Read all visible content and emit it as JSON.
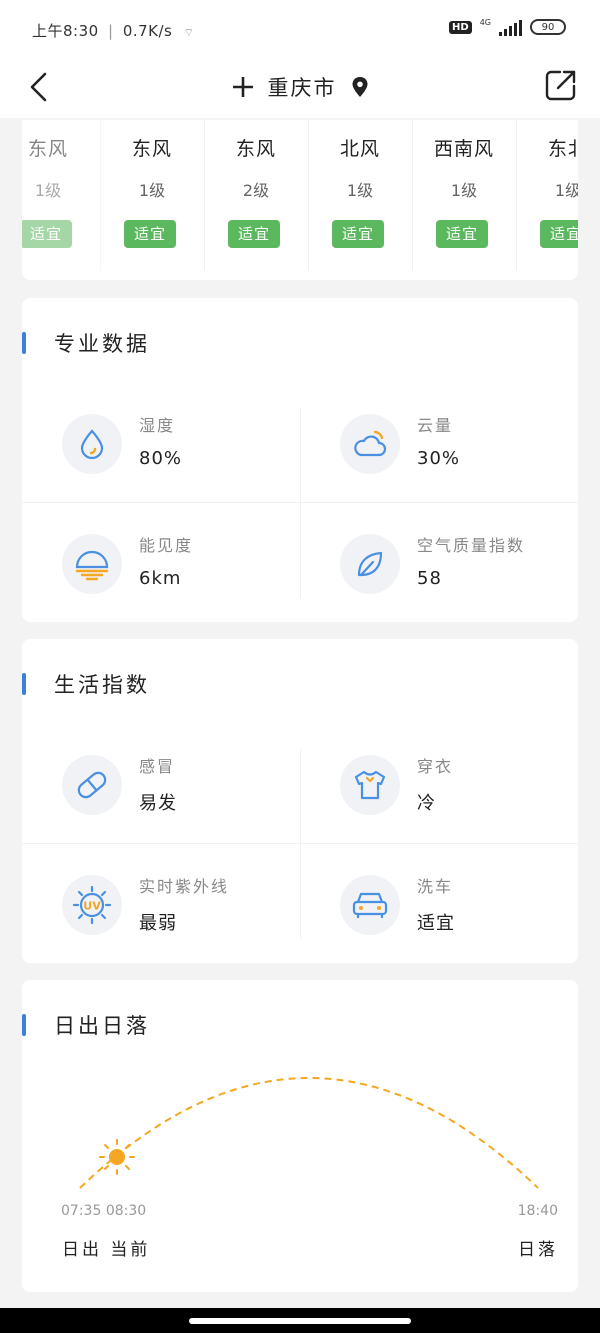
{
  "status": {
    "time": "上午8:30",
    "speed": "0.7K/s",
    "hd": "HD",
    "net": "4G",
    "battery": "90"
  },
  "header": {
    "city": "重庆市"
  },
  "wind": [
    {
      "dir": "东风",
      "level": "1级",
      "tag": "适宜"
    },
    {
      "dir": "东风",
      "level": "1级",
      "tag": "适宜"
    },
    {
      "dir": "东风",
      "level": "2级",
      "tag": "适宜"
    },
    {
      "dir": "北风",
      "level": "1级",
      "tag": "适宜"
    },
    {
      "dir": "西南风",
      "level": "1级",
      "tag": "适宜"
    },
    {
      "dir": "东北",
      "level": "1级",
      "tag": "适宜"
    }
  ],
  "pro": {
    "title": "专业数据",
    "items": [
      {
        "label": "湿度",
        "value": "80%",
        "icon": "drop-icon"
      },
      {
        "label": "云量",
        "value": "30%",
        "icon": "cloud-icon"
      },
      {
        "label": "能见度",
        "value": "6km",
        "icon": "visibility-icon"
      },
      {
        "label": "空气质量指数",
        "value": "58",
        "icon": "leaf-icon"
      }
    ]
  },
  "life": {
    "title": "生活指数",
    "items": [
      {
        "label": "感冒",
        "value": "易发",
        "icon": "pill-icon"
      },
      {
        "label": "穿衣",
        "value": "冷",
        "icon": "shirt-icon"
      },
      {
        "label": "实时紫外线",
        "value": "最弱",
        "icon": "uv-icon"
      },
      {
        "label": "洗车",
        "value": "适宜",
        "icon": "car-icon"
      }
    ]
  },
  "sun": {
    "title": "日出日落",
    "sunrise_time": "07:35",
    "now_time": "08:30",
    "sunset_time": "18:40",
    "sunrise_label": "日出",
    "now_label": "当前",
    "sunset_label": "日落"
  },
  "colors": {
    "accent": "#3b82d6",
    "tag_green": "#5cb85f",
    "sun_orange": "#f5a623"
  }
}
